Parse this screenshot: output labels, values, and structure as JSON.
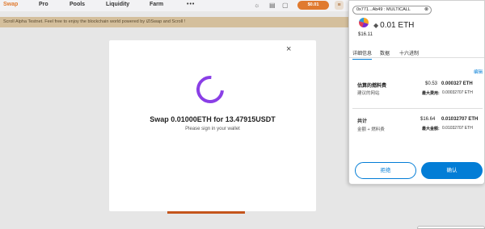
{
  "nav": {
    "items": [
      "Swap",
      "Pro",
      "Pools",
      "Liquidity",
      "Farm"
    ],
    "more": "•••",
    "wallet_chip": "$0.01",
    "icons": [
      "sun-icon",
      "book-icon",
      "clipboard-icon",
      "menu-icon"
    ]
  },
  "banner": {
    "text": "Scroll Alpha Testnet. Feel free to enjoy the blockchain world powered by iZiSwap and Scroll !"
  },
  "modal": {
    "title": "Swap 0.01000ETH for 13.47915USDT",
    "subtitle": "Please sign in your wallet",
    "close": "×"
  },
  "metamask": {
    "address": "0x771...Ab49 : MULTICALL",
    "address_close": "⊗",
    "amount": "0.01 ETH",
    "usd": "$16.11",
    "tabs": [
      "详细信息",
      "数据",
      "十六进制"
    ],
    "edit": "编辑",
    "gas_label": "估算的燃料费",
    "gas_fiat": "$0.53",
    "gas_eth": "0.000327 ETH",
    "recommended": "建议的网站",
    "max_fee_label": "最大费用:",
    "max_fee_value": "0.00032707 ETH",
    "total_label": "共计",
    "total_fiat": "$16.64",
    "total_eth": "0.01032707 ETH",
    "amount_fee_label": "金额 + 燃料费",
    "max_amount_label": "最大金额:",
    "max_amount_value": "0.01032707 ETH",
    "reject": "拒绝",
    "confirm": "确认"
  },
  "colors": {
    "accent": "#e07a2f",
    "spinner": "#8a3fe6",
    "metamask_blue": "#037dd6"
  }
}
